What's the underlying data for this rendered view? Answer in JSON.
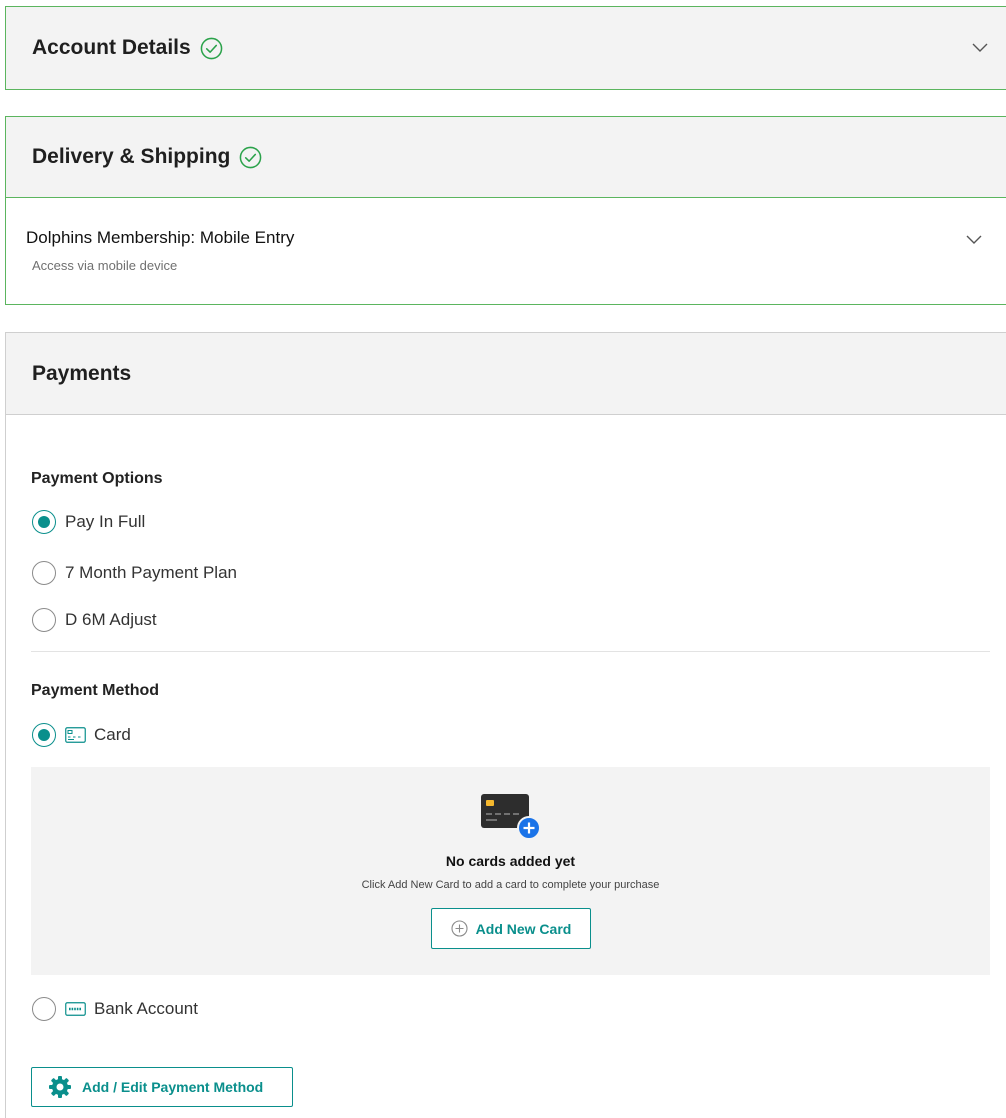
{
  "account_details": {
    "title": "Account Details",
    "check_icon": "check-circle-icon",
    "chevron_icon": "chevron-down-icon"
  },
  "delivery": {
    "title": "Delivery & Shipping",
    "option_prefix": "Dolphins Membership:",
    "option_name": "Mobile Entry",
    "option_sub": "Access via mobile device"
  },
  "payments": {
    "title": "Payments",
    "options_title": "Payment Options",
    "options": [
      {
        "label": "Pay In Full",
        "selected": true
      },
      {
        "label": "7 Month Payment Plan",
        "selected": false
      },
      {
        "label": "D 6M Adjust",
        "selected": false
      }
    ],
    "method_title": "Payment Method",
    "methods": [
      {
        "label": "Card",
        "icon": "card-icon",
        "selected": true
      },
      {
        "label": "Bank Account",
        "icon": "bank-icon",
        "selected": false
      }
    ],
    "empty_title": "No cards added yet",
    "empty_sub": "Click Add New Card to add a card to complete your purchase",
    "add_card_label": "Add New Card",
    "edit_method_label": "Add / Edit Payment Method"
  },
  "colors": {
    "accent": "#0a8f8c",
    "complete_border": "#5bb55e",
    "header_bg": "#f3f3f3",
    "plus_blue": "#1a73e8"
  }
}
